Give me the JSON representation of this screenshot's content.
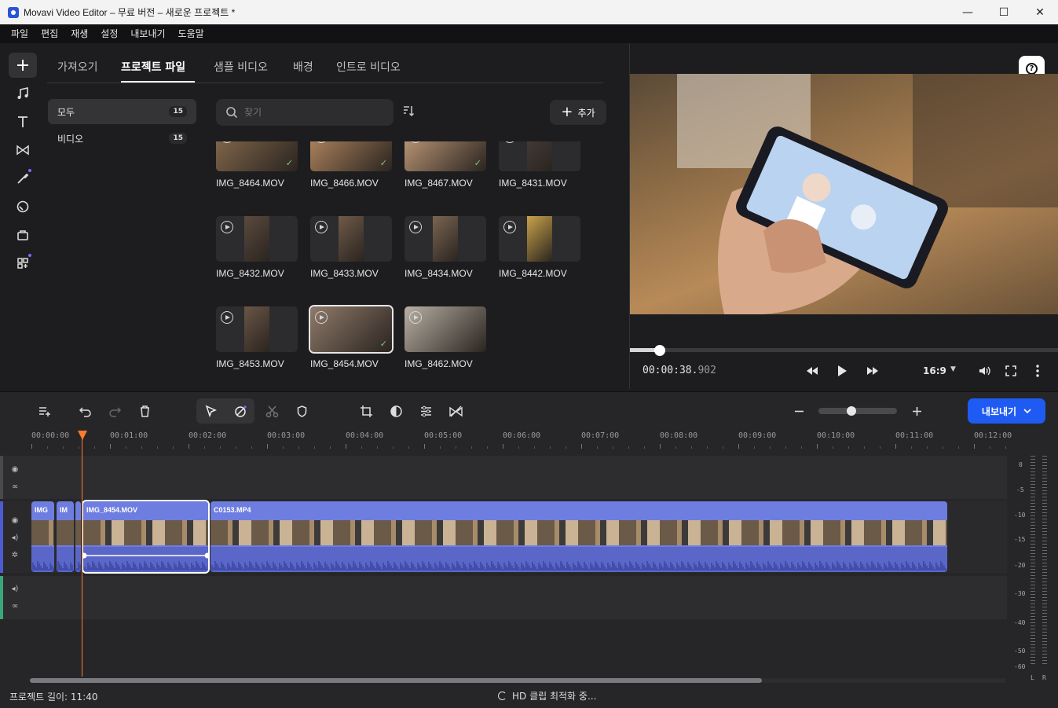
{
  "window": {
    "title": "Movavi Video Editor – 무료 버전 – 새로운 프로젝트 *",
    "minimize": "—",
    "maximize": "☐",
    "close": "✕"
  },
  "menu": [
    "파일",
    "편집",
    "재생",
    "설정",
    "내보내기",
    "도움말"
  ],
  "tabs": [
    {
      "label": "가져오기",
      "active": false
    },
    {
      "label": "프로젝트 파일",
      "active": true
    },
    {
      "label": "샘플 비디오",
      "active": false
    },
    {
      "label": "배경",
      "active": false
    },
    {
      "label": "인트로 비디오",
      "active": false
    }
  ],
  "categories": [
    {
      "label": "모두",
      "count": "15",
      "active": true
    },
    {
      "label": "비디오",
      "count": "15",
      "active": false
    }
  ],
  "search": {
    "placeholder": "찾기"
  },
  "add_button": "추가",
  "media": [
    {
      "name": "IMG_8464.MOV",
      "checked": true,
      "selected": false
    },
    {
      "name": "IMG_8466.MOV",
      "checked": true,
      "selected": false
    },
    {
      "name": "IMG_8467.MOV",
      "checked": true,
      "selected": false
    },
    {
      "name": "IMG_8431.MOV",
      "checked": false,
      "selected": false
    },
    {
      "name": "IMG_8432.MOV",
      "checked": false,
      "selected": false
    },
    {
      "name": "IMG_8433.MOV",
      "checked": false,
      "selected": false
    },
    {
      "name": "IMG_8434.MOV",
      "checked": false,
      "selected": false
    },
    {
      "name": "IMG_8442.MOV",
      "checked": false,
      "selected": false
    },
    {
      "name": "IMG_8453.MOV",
      "checked": false,
      "selected": false
    },
    {
      "name": "IMG_8454.MOV",
      "checked": true,
      "selected": true
    },
    {
      "name": "IMG_8462.MOV",
      "checked": false,
      "selected": false
    }
  ],
  "player": {
    "time_main": "00:00:38.",
    "time_ms": "902",
    "aspect": "16:9",
    "progress": 0.07
  },
  "timeline": {
    "ruler": [
      "00:00:00",
      "00:01:00",
      "00:02:00",
      "00:03:00",
      "00:04:00",
      "00:05:00",
      "00:06:00",
      "00:07:00",
      "00:08:00",
      "00:09:00",
      "00:10:00",
      "00:11:00",
      "00:12:00"
    ],
    "clips": [
      {
        "name": "IMG",
        "selected": false
      },
      {
        "name": "IM",
        "selected": false
      },
      {
        "name": "",
        "selected": false
      },
      {
        "name": "IMG_8454.MOV",
        "selected": true
      },
      {
        "name": "C0153.MP4",
        "selected": false
      }
    ],
    "zoom": 0.42
  },
  "meter": {
    "labels": [
      "0",
      "-5",
      "-10",
      "-15",
      "-20",
      "-30",
      "-40",
      "-50",
      "-60"
    ],
    "left": "L",
    "right": "R"
  },
  "export_button": "내보내기",
  "status": {
    "project_length": "프로젝트 길이: 11:40",
    "task": "HD 클립 최적화 중..."
  },
  "colors": {
    "accent": "#1f5bf2",
    "clip": "#6e7de0",
    "playhead": "#ff7a2e"
  }
}
